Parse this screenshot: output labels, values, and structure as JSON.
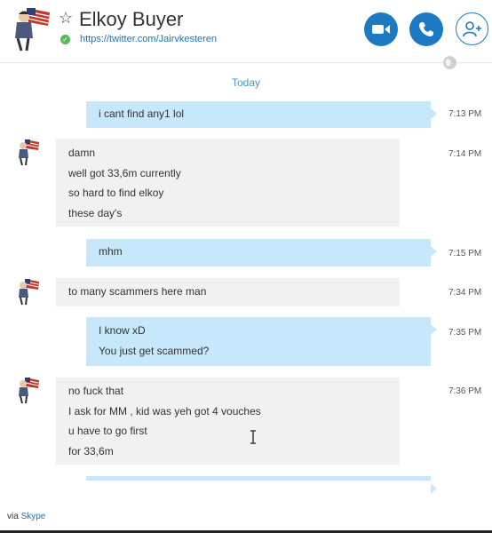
{
  "header": {
    "contact_name": "Elkoy Buyer",
    "profile_link": "https://twitter.com/Jairvkesteren",
    "icons": [
      "star-icon",
      "status-check-icon",
      "video-call-icon",
      "phone-call-icon",
      "add-contact-icon",
      "globe-icon"
    ]
  },
  "conversation": {
    "day_label": "Today",
    "messages": [
      {
        "direction": "out",
        "time": "7:13 PM",
        "lines": [
          "i cant find any1 lol"
        ]
      },
      {
        "direction": "in",
        "time": "7:14 PM",
        "lines": [
          "damn",
          "well got 33,6m currently",
          "so hard to find elkoy",
          "these day's"
        ]
      },
      {
        "direction": "out",
        "time": "7:15 PM",
        "lines": [
          "mhm"
        ]
      },
      {
        "direction": "in",
        "time": "7:34 PM",
        "lines": [
          "to many scammers here man"
        ]
      },
      {
        "direction": "out",
        "time": "7:35 PM",
        "lines": [
          "I know xD",
          "You just get scammed?"
        ]
      },
      {
        "direction": "in",
        "time": "7:36 PM",
        "lines": [
          "no fuck that",
          "I ask for MM , kid was yeh got 4 vouches",
          "u have to go first",
          "for 33,6m"
        ]
      }
    ]
  },
  "footer": {
    "via": "via",
    "service": "Skype"
  },
  "colors": {
    "accent": "#1b7ac2",
    "outgoing_bubble": "#c7e8fa",
    "incoming_bubble": "#f1f1f1",
    "link": "#1e73be",
    "status_online": "#5cb85c"
  }
}
